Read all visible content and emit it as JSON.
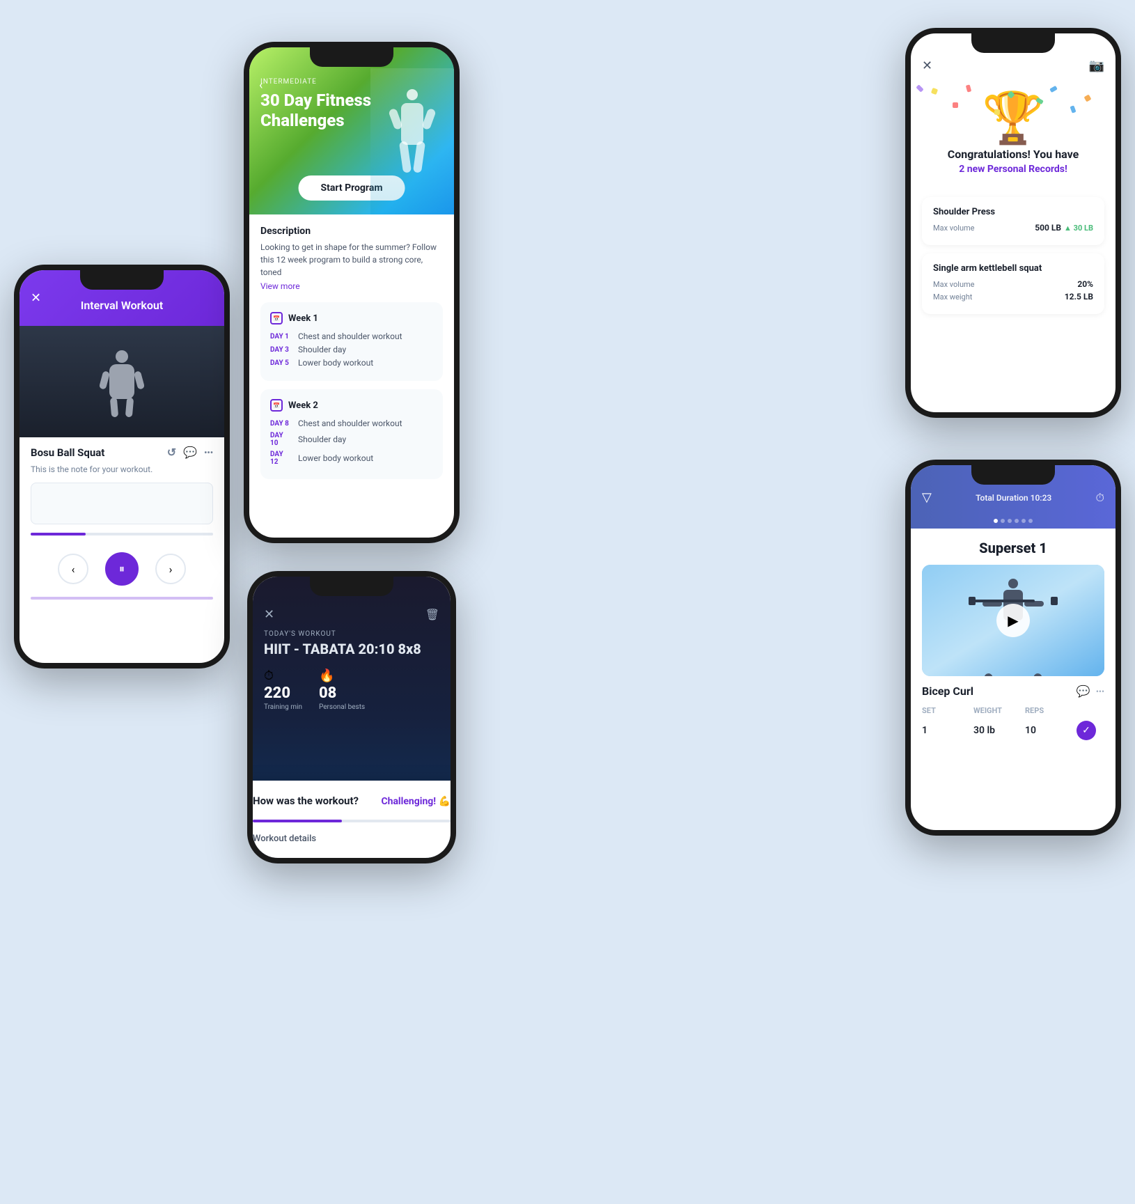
{
  "background": "#dce8f5",
  "phone1": {
    "title": "Interval Workout",
    "exercise_name": "Bosu Ball Squat",
    "note_text": "This is the note for your workout.",
    "close_icon": "✕",
    "replay_icon": "↺",
    "comment_icon": "💬",
    "more_icon": "•••",
    "prev_icon": "‹",
    "pause_icon": "⏸",
    "next_icon": "›"
  },
  "phone2": {
    "level": "INTERMEDIATE",
    "title": "30 Day Fitness Challenges",
    "start_btn": "Start Program",
    "back_icon": "‹",
    "desc_title": "Description",
    "desc_text": "Looking to get in shape for the summer? Follow this 12 week program to build a strong core, toned",
    "view_more": "View more",
    "weeks": [
      {
        "label": "Week 1",
        "days": [
          {
            "day": "DAY 1",
            "workout": "Chest and shoulder workout"
          },
          {
            "day": "DAY 3",
            "workout": "Shoulder day"
          },
          {
            "day": "DAY 5",
            "workout": "Lower body workout"
          }
        ]
      },
      {
        "label": "Week 2",
        "days": [
          {
            "day": "DAY 8",
            "workout": "Chest and shoulder workout"
          },
          {
            "day": "DAY 10",
            "workout": "Shoulder day"
          },
          {
            "day": "DAY 12",
            "workout": "Lower body workout"
          }
        ]
      }
    ]
  },
  "phone3": {
    "close_icon": "✕",
    "camera_icon": "📷",
    "trophy_emoji": "🏆",
    "congrats_text": "Congratulations! You have",
    "records_text": "2 new Personal Records!",
    "records": [
      {
        "name": "Shoulder Press",
        "metrics": [
          {
            "label": "Max volume",
            "value": "500 LB",
            "increase": "▲ 30 LB"
          }
        ]
      },
      {
        "name": "Single arm kettlebell squat",
        "metrics": [
          {
            "label": "Max volume",
            "value": "20%",
            "increase": ""
          },
          {
            "label": "Max weight",
            "value": "12.5 LB",
            "increase": ""
          }
        ]
      }
    ]
  },
  "phone4": {
    "close_icon": "✕",
    "delete_icon": "🗑",
    "workout_label": "TODAY'S WORKOUT",
    "workout_title": "HIIT - TABATA 20:10 8x8",
    "stats": [
      {
        "icon": "⏱",
        "value": "220",
        "label": "Training min"
      },
      {
        "icon": "🔥",
        "value": "08",
        "label": "Personal bests"
      }
    ],
    "popup": {
      "question": "How was the workout?",
      "answer": "Challenging! 💪"
    },
    "workout_details": "Workout details"
  },
  "phone5": {
    "chevron_down": "▽",
    "duration_label": "Total Duration",
    "duration_value": "10:23",
    "timer_icon": "⏱",
    "superset_title": "Superset 1",
    "exercise_name": "Bicep Curl",
    "play_icon": "▶",
    "comment_icon": "💬",
    "more_icon": "•••",
    "table_headers": [
      "SET",
      "WEIGHT",
      "REPS",
      ""
    ],
    "sets": [
      {
        "set": "1",
        "weight": "30 lb",
        "reps": "10",
        "done": true
      }
    ]
  }
}
